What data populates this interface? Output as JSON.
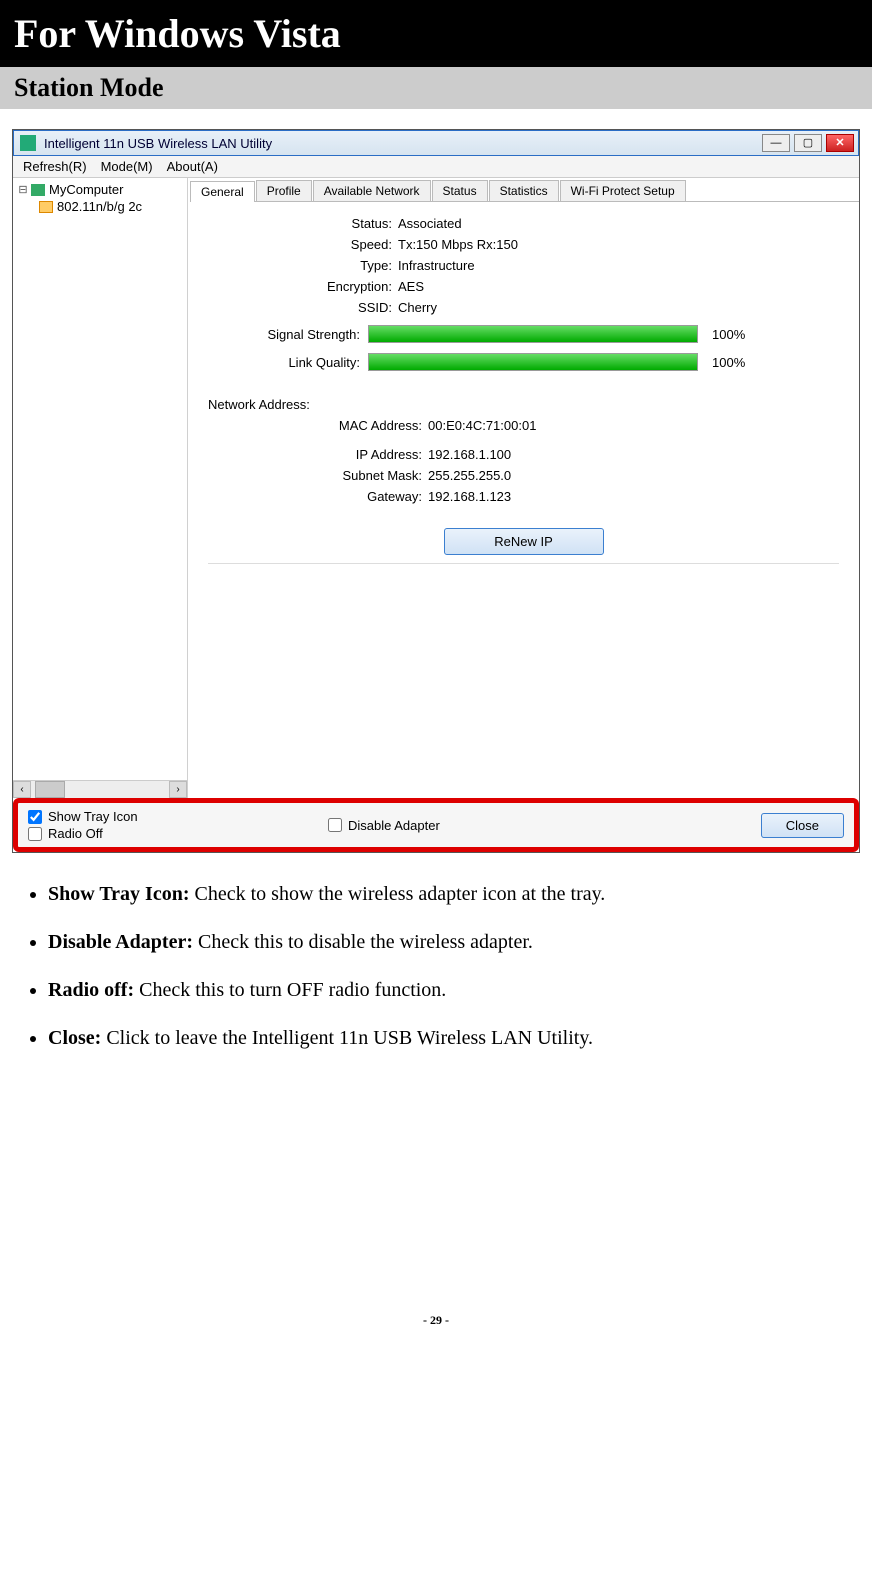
{
  "page": {
    "title": "For Windows Vista",
    "subtitle": "Station Mode",
    "page_number": "- 29 -"
  },
  "window": {
    "title": "Intelligent 11n USB Wireless LAN Utility",
    "menu": {
      "refresh": "Refresh(R)",
      "mode": "Mode(M)",
      "about": "About(A)"
    },
    "tree": {
      "root": "MyComputer",
      "child": "802.11n/b/g 2c"
    },
    "tabs": [
      "General",
      "Profile",
      "Available Network",
      "Status",
      "Statistics",
      "Wi-Fi Protect Setup"
    ],
    "general": {
      "status_label": "Status:",
      "status_value": "Associated",
      "speed_label": "Speed:",
      "speed_value": "Tx:150 Mbps Rx:150",
      "type_label": "Type:",
      "type_value": "Infrastructure",
      "encryption_label": "Encryption:",
      "encryption_value": "AES",
      "ssid_label": "SSID:",
      "ssid_value": "Cherry",
      "signal_label": "Signal Strength:",
      "signal_pct": "100%",
      "signal_val": 100,
      "link_label": "Link Quality:",
      "link_pct": "100%",
      "link_val": 100,
      "net_header": "Network Address:",
      "mac_label": "MAC Address:",
      "mac_value": "00:E0:4C:71:00:01",
      "ip_label": "IP Address:",
      "ip_value": "192.168.1.100",
      "subnet_label": "Subnet Mask:",
      "subnet_value": "255.255.255.0",
      "gateway_label": "Gateway:",
      "gateway_value": "192.168.1.123",
      "renew_btn": "ReNew IP"
    },
    "footer": {
      "show_tray": "Show Tray Icon",
      "radio_off": "Radio Off",
      "disable_adapter": "Disable Adapter",
      "close_btn": "Close"
    }
  },
  "bullets": {
    "b1_bold": "Show Tray Icon:",
    "b1_rest": " Check to show the wireless adapter icon at the tray.",
    "b2_bold": "Disable Adapter:",
    "b2_rest": " Check this to disable the wireless adapter.",
    "b3_bold": "Radio off:",
    "b3_rest": " Check this to turn OFF radio function.",
    "b4_bold": "Close:",
    "b4_rest": " Click to leave the Intelligent 11n USB Wireless LAN Utility."
  }
}
